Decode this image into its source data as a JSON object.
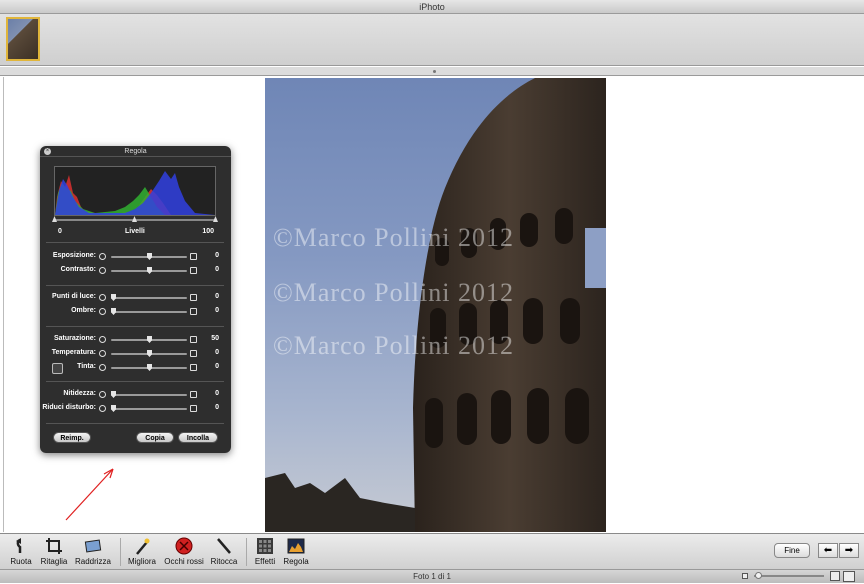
{
  "app_title": "iPhoto",
  "watermark": "©Marco Pollini 2012",
  "panel": {
    "title": "Regola",
    "levels": {
      "min": "0",
      "label": "Livelli",
      "max": "100"
    },
    "rows": [
      {
        "label": "Esposizione:",
        "value": "0",
        "pos": 0.5
      },
      {
        "label": "Contrasto:",
        "value": "0",
        "pos": 0.5
      },
      {
        "label": "Punti di luce:",
        "value": "0",
        "pos": 0.0
      },
      {
        "label": "Ombre:",
        "value": "0",
        "pos": 0.0
      },
      {
        "label": "Saturazione:",
        "value": "50",
        "pos": 0.5
      },
      {
        "label": "Temperatura:",
        "value": "0",
        "pos": 0.5
      },
      {
        "label": "Tinta:",
        "value": "0",
        "pos": 0.5
      },
      {
        "label": "Nitidezza:",
        "value": "0",
        "pos": 0.0
      },
      {
        "label": "Riduci disturbo:",
        "value": "0",
        "pos": 0.0
      }
    ],
    "buttons": {
      "reset": "Reimp.",
      "copy": "Copia",
      "paste": "Incolla"
    }
  },
  "toolbar": {
    "rotate": "Ruota",
    "crop": "Ritaglia",
    "straighten": "Raddrizza",
    "enhance": "Migliora",
    "redeye": "Occhi rossi",
    "retouch": "Ritocca",
    "effects": "Effetti",
    "adjust": "Regola",
    "done": "Fine",
    "prev_icon": "arrow-left-icon",
    "next_icon": "arrow-right-icon"
  },
  "status": "Foto 1 di 1",
  "colors": {
    "arrow": "#e02020",
    "thumb_border": "#e0b53a"
  }
}
